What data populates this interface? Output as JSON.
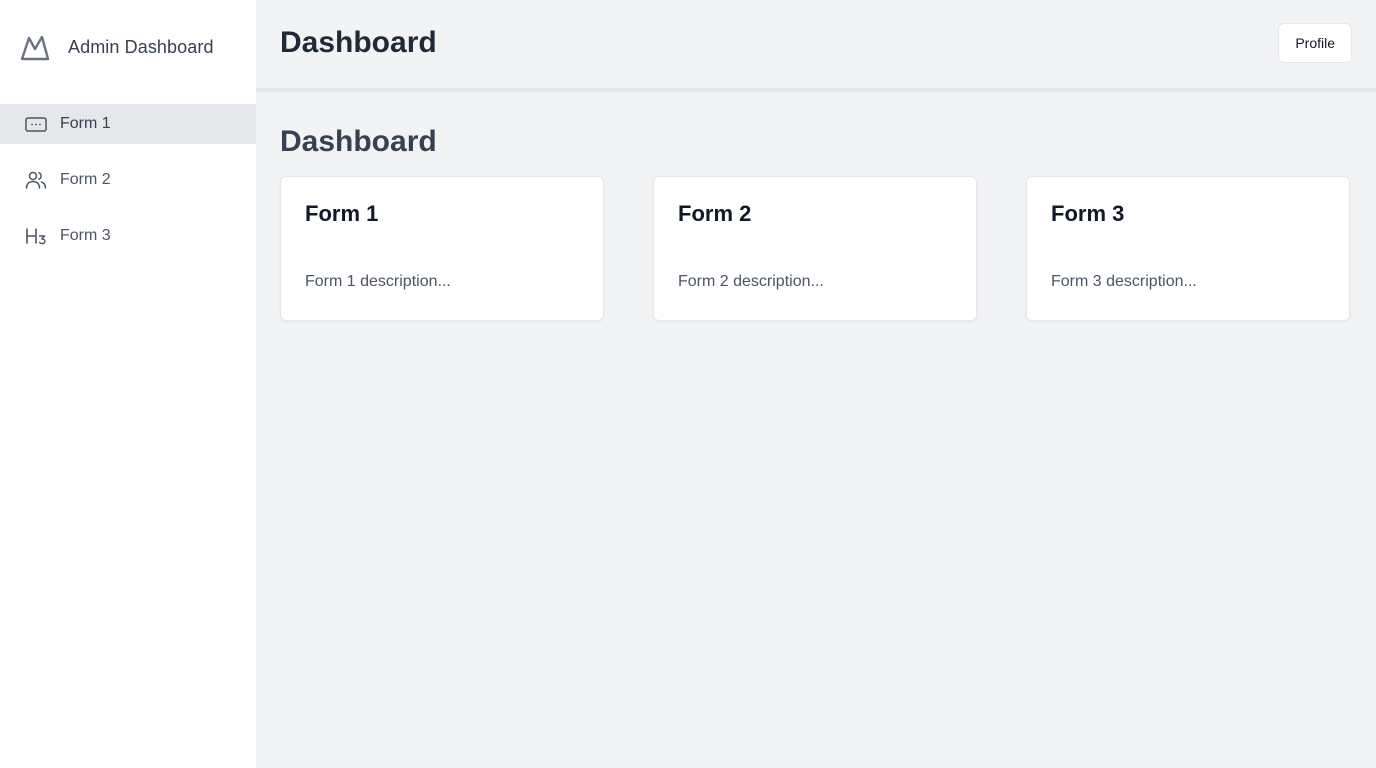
{
  "sidebar": {
    "brand": {
      "title": "Admin Dashboard",
      "icon": "mountain-logo-icon"
    },
    "items": [
      {
        "label": "Form 1",
        "icon": "keyboard-icon",
        "active": true
      },
      {
        "label": "Form 2",
        "icon": "users-icon",
        "active": false
      },
      {
        "label": "Form 3",
        "icon": "heading-3-icon",
        "active": false
      }
    ]
  },
  "header": {
    "title": "Dashboard",
    "profile_label": "Profile"
  },
  "main": {
    "title": "Dashboard",
    "cards": [
      {
        "title": "Form 1",
        "description": "Form 1 description..."
      },
      {
        "title": "Form 2",
        "description": "Form 2 description..."
      },
      {
        "title": "Form 3",
        "description": "Form 3 description..."
      }
    ]
  },
  "colors": {
    "background": "#f2f3f5",
    "sidebar": "#ffffff",
    "active_item": "#e5e7eb",
    "card": "#ffffff",
    "text_dark": "#1f2937"
  }
}
